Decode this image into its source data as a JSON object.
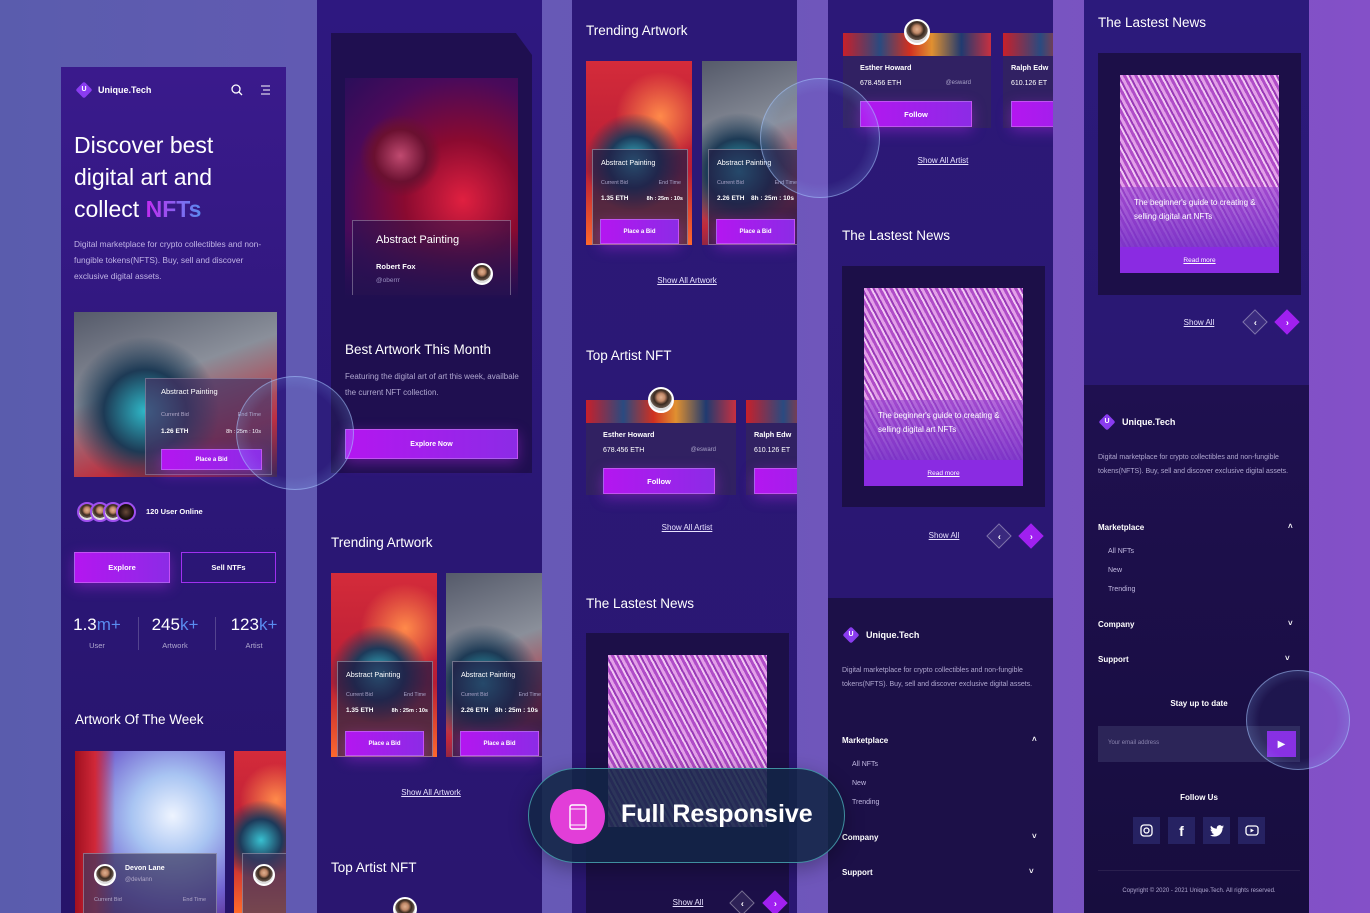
{
  "brand": {
    "name": "Unique.Tech",
    "letter": "U"
  },
  "colors": {
    "accent": "#a020f0",
    "highlight_blue": "#5a8cf0",
    "badge_pink": "#e23ed8"
  },
  "hero": {
    "title_line1": "Discover best",
    "title_line2": "digital art and",
    "title_prefix": "collect ",
    "title_highlight": "NFTs",
    "desc": "Digital marketplace for crypto collectibles and non-fungible tokens(NFTS). Buy, sell and discover exclusive digital assets.",
    "card": {
      "title": "Abstract Painting",
      "bid_label": "Current Bid",
      "end_label": "End Time",
      "bid": "1.26 ETH",
      "time": "8h : 25m : 10s",
      "button": "Place a Bid"
    },
    "online": "120 User Online",
    "explore": "Explore",
    "sell": "Sell NTFs",
    "stats": [
      {
        "value": "1.3",
        "unit": "m+",
        "label": "User"
      },
      {
        "value": "245",
        "unit": "k+",
        "label": "Artwork"
      },
      {
        "value": "123",
        "unit": "k+",
        "label": "Artist"
      }
    ]
  },
  "week": {
    "title": "Artwork Of The Week",
    "card": {
      "name": "Devon Lane",
      "handle": "@devlann",
      "bid_label": "Current Bid",
      "end_label": "End Time"
    }
  },
  "best": {
    "card_title": "Abstract Painting",
    "artist": "Robert Fox",
    "handle": "@oberrr",
    "title": "Best Artwork This Month",
    "desc": "Featuring the digital art of art this week, availbale the current NFT collection.",
    "button": "Explore Now"
  },
  "trending": {
    "title": "Trending Artwork",
    "bid_label": "Current Bid",
    "end_label": "End Time",
    "button": "Place a Bid",
    "items": [
      {
        "title": "Abstract Painting",
        "bid": "1.35 ETH",
        "time": "8h : 25m : 10s"
      },
      {
        "title": "Abstract Painting",
        "bid": "2.26 ETH",
        "time": "8h : 25m : 10s"
      }
    ],
    "show_all": "Show All Artwork"
  },
  "artists": {
    "title": "Top Artist NFT",
    "items": [
      {
        "name": "Esther Howard",
        "eth": "678.456 ETH",
        "handle": "@esward"
      },
      {
        "name": "Ralph Edw",
        "eth": "610.126 ET"
      }
    ],
    "follow": "Follow",
    "show_all": "Show All Artist"
  },
  "news": {
    "title": "The Lastest News",
    "headline": "The beginner's guide to creating & selling digital art NFTs",
    "read_more": "Read more",
    "show_all": "Show All"
  },
  "footer": {
    "desc": "Digital marketplace for crypto collectibles and non-fungible tokens(NFTS). Buy, sell and discover exclusive digital assets.",
    "marketplace": {
      "label": "Marketplace",
      "items": [
        "All NFTs",
        "New",
        "Trending"
      ]
    },
    "company": "Company",
    "support": "Support",
    "stay": "Stay up to date",
    "email_placeholder": "Your email address",
    "follow": "Follow Us",
    "social": [
      "instagram-icon",
      "facebook-icon",
      "twitter-icon",
      "youtube-icon"
    ],
    "copyright": "Copyright © 2020 - 2021 Unique.Tech. All rights reserved."
  },
  "badge": {
    "label": "Full Responsive"
  }
}
